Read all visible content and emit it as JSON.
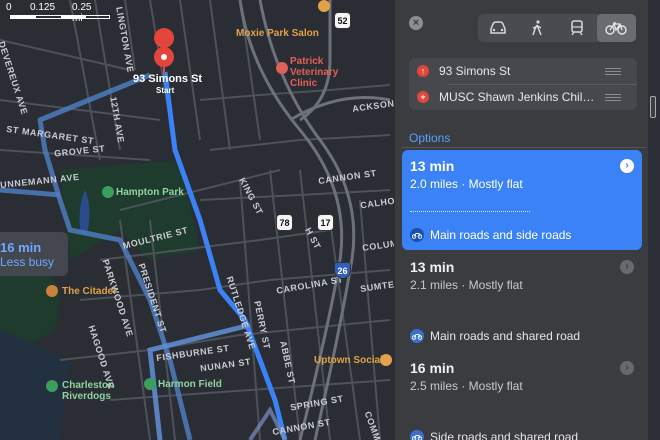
{
  "map": {
    "scale": {
      "zero": "0",
      "mid": "0.125",
      "end": "0.25 mi"
    },
    "streets": {
      "devereux": "DEVEREUX AVE",
      "lington": "LINGTON AVE",
      "twelfth": "12TH AVE",
      "st_margaret": "ST MARGARET ST",
      "grove": "GROVE ST",
      "cunnemann": "UNNEMANN AVE",
      "moultrie": "MOULTRIE ST",
      "parkwood": "PARKWOOD AVE",
      "president": "PRESIDENT ST",
      "hagood": "HAGOOD AVE",
      "rutledge": "RUTLEDGE AVE",
      "fishburne": "FISHBURNE ST",
      "nunan": "NUNAN ST",
      "perry": "PERRY ST",
      "carolina": "CAROLINA ST",
      "abbe": "ABBE ST",
      "king": "KING ST",
      "h_st": "H ST",
      "cannon": "CANNON ST",
      "spring": "SPRING ST",
      "calhoun": "CALHOUN ST",
      "sumter": "SUMTER ST",
      "columbus": "COLUMBUS ST",
      "ackson": "ACKSON ST",
      "cannon_right": "CANNON ST",
      "comm": "COMM"
    },
    "pois": {
      "moxie": "Moxie Park Salon",
      "vet": "Patrick Veterinary Clinic",
      "hampton": "Hampton Park",
      "citadel": "The Citadel",
      "charleston": "Charleston Riverdogs",
      "harmon": "Harmon Field",
      "uptown": "Uptown Social"
    },
    "shields": {
      "us52": "52",
      "us78": "78",
      "us17": "17",
      "i26": "26"
    },
    "pin": {
      "name": "93 Simons St",
      "sub": "Start"
    },
    "badge": {
      "time": "16 min",
      "note": "Less busy"
    },
    "colors": {
      "route": "#3a82f6",
      "alt_route": "#5f92d8",
      "land": "#2a2d33",
      "road": "#5a5e66",
      "park": "#1f3b2d"
    }
  },
  "panel": {
    "close": "×",
    "modes": [
      {
        "name": "car-icon",
        "active": false
      },
      {
        "name": "walk-icon",
        "active": false
      },
      {
        "name": "transit-icon",
        "active": false
      },
      {
        "name": "bike-icon",
        "active": true
      }
    ],
    "stops": [
      {
        "icon": "pin-icon",
        "text": "93 Simons St"
      },
      {
        "icon": "plus-icon",
        "text": "MUSC Shawn Jenkins Childre..."
      }
    ],
    "options_label": "Options",
    "routes": [
      {
        "time": "13 min",
        "meta": "2.0 miles · Mostly flat",
        "road": "Main roads and side roads",
        "selected": true
      },
      {
        "time": "13 min",
        "meta": "2.1 miles · Mostly flat",
        "road": "Main roads and shared road",
        "selected": false
      },
      {
        "time": "16 min",
        "meta": "2.5 miles · Mostly flat",
        "road": "Side roads and shared road",
        "selected": false
      }
    ]
  }
}
